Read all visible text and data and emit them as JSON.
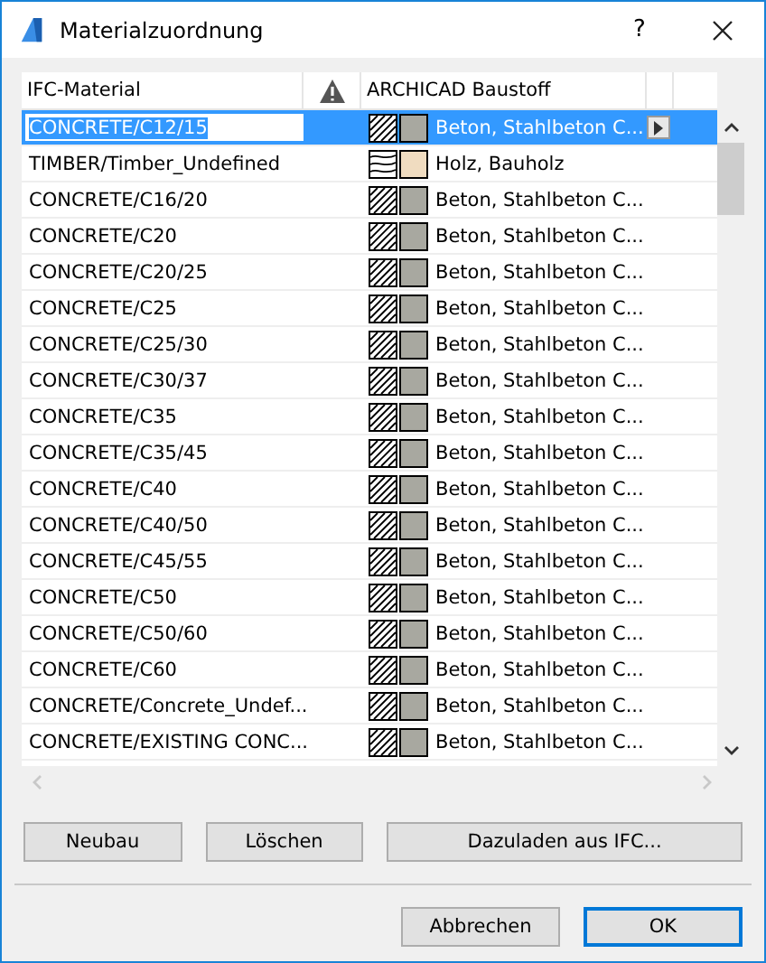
{
  "window": {
    "title": "Materialzuordnung",
    "help": "?"
  },
  "table": {
    "columns": [
      "IFC-Material",
      "ARCHICAD Baustoff"
    ],
    "rows": [
      {
        "name": "CONCRETE/C12/15",
        "kind": "diagonal",
        "color": "#a8a8a0",
        "material": "Beton, Stahlbeton C...",
        "selected": true
      },
      {
        "name": "TIMBER/Timber_Undefined",
        "kind": "wood",
        "color": "#f0dcc0",
        "material": "Holz, Bauholz",
        "selected": false
      },
      {
        "name": "CONCRETE/C16/20",
        "kind": "diagonal",
        "color": "#a8a8a0",
        "material": "Beton, Stahlbeton C...",
        "selected": false
      },
      {
        "name": "CONCRETE/C20",
        "kind": "diagonal",
        "color": "#a8a8a0",
        "material": "Beton, Stahlbeton C...",
        "selected": false
      },
      {
        "name": "CONCRETE/C20/25",
        "kind": "diagonal",
        "color": "#a8a8a0",
        "material": "Beton, Stahlbeton C...",
        "selected": false
      },
      {
        "name": "CONCRETE/C25",
        "kind": "diagonal",
        "color": "#a8a8a0",
        "material": "Beton, Stahlbeton C...",
        "selected": false
      },
      {
        "name": "CONCRETE/C25/30",
        "kind": "diagonal",
        "color": "#a8a8a0",
        "material": "Beton, Stahlbeton C...",
        "selected": false
      },
      {
        "name": "CONCRETE/C30/37",
        "kind": "diagonal",
        "color": "#a8a8a0",
        "material": "Beton, Stahlbeton C...",
        "selected": false
      },
      {
        "name": "CONCRETE/C35",
        "kind": "diagonal",
        "color": "#a8a8a0",
        "material": "Beton, Stahlbeton C...",
        "selected": false
      },
      {
        "name": "CONCRETE/C35/45",
        "kind": "diagonal",
        "color": "#a8a8a0",
        "material": "Beton, Stahlbeton C...",
        "selected": false
      },
      {
        "name": "CONCRETE/C40",
        "kind": "diagonal",
        "color": "#a8a8a0",
        "material": "Beton, Stahlbeton C...",
        "selected": false
      },
      {
        "name": "CONCRETE/C40/50",
        "kind": "diagonal",
        "color": "#a8a8a0",
        "material": "Beton, Stahlbeton C...",
        "selected": false
      },
      {
        "name": "CONCRETE/C45/55",
        "kind": "diagonal",
        "color": "#a8a8a0",
        "material": "Beton, Stahlbeton C...",
        "selected": false
      },
      {
        "name": "CONCRETE/C50",
        "kind": "diagonal",
        "color": "#a8a8a0",
        "material": "Beton, Stahlbeton C...",
        "selected": false
      },
      {
        "name": "CONCRETE/C50/60",
        "kind": "diagonal",
        "color": "#a8a8a0",
        "material": "Beton, Stahlbeton C...",
        "selected": false
      },
      {
        "name": "CONCRETE/C60",
        "kind": "diagonal",
        "color": "#a8a8a0",
        "material": "Beton, Stahlbeton C...",
        "selected": false
      },
      {
        "name": "CONCRETE/Concrete_Undef...",
        "kind": "diagonal",
        "color": "#a8a8a0",
        "material": "Beton, Stahlbeton C...",
        "selected": false
      },
      {
        "name": "CONCRETE/EXISTING CONC...",
        "kind": "diagonal",
        "color": "#a8a8a0",
        "material": "Beton, Stahlbeton C...",
        "selected": false
      }
    ]
  },
  "buttons": [
    "Neubau",
    "Löschen",
    "Dazuladen aus IFC..."
  ],
  "footer_buttons": [
    {
      "label": "Abbrechen",
      "default": false
    },
    {
      "label": "OK",
      "default": true
    }
  ]
}
